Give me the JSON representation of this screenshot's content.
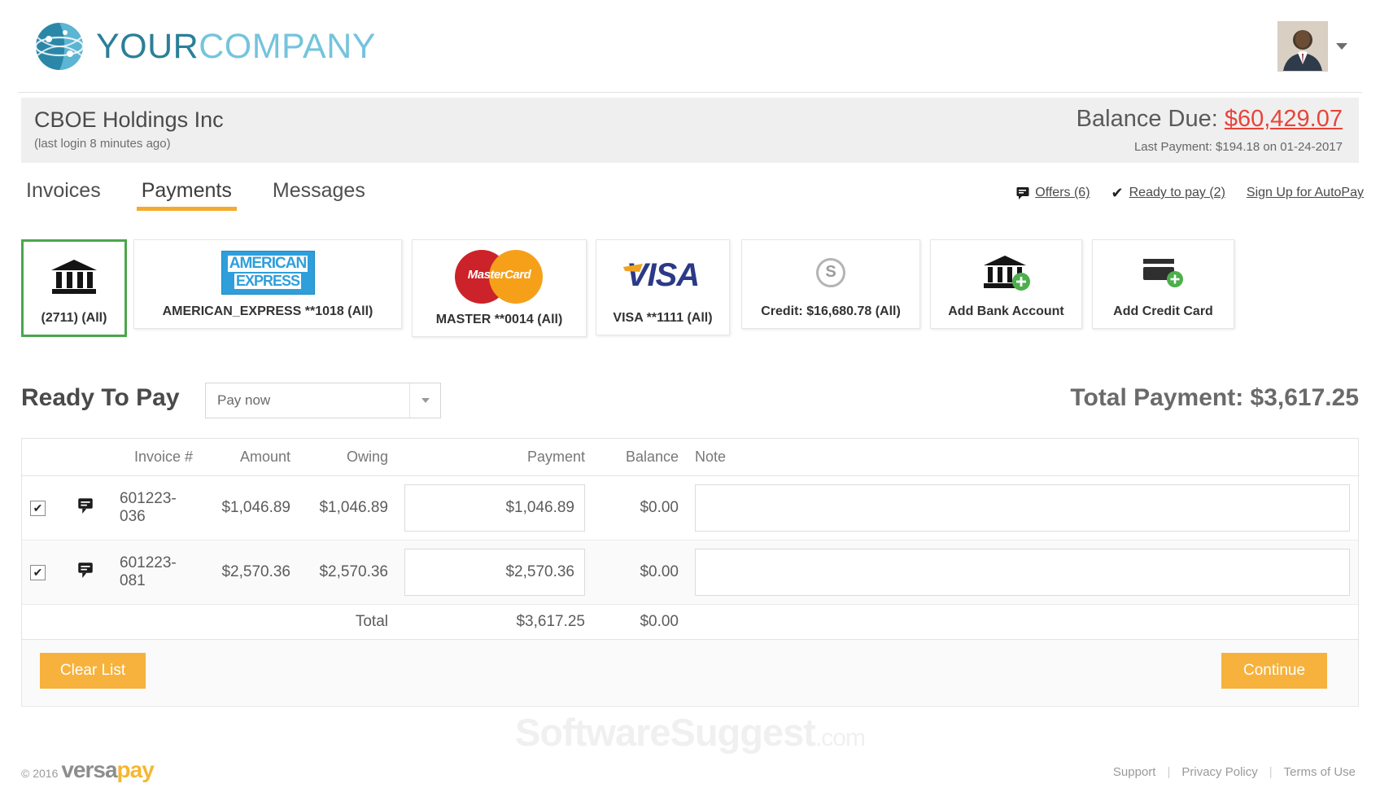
{
  "brand": {
    "logo_text_part1": "YOUR",
    "logo_text_part2": "COMPANY",
    "logo_icon": "globe-icon",
    "accent_color": "#f3ab2e",
    "brand_blue": "#2b7f98"
  },
  "header": {
    "avatar_icon": "user-avatar",
    "account_menu_icon": "chevron-down-icon"
  },
  "account": {
    "name": "CBOE Holdings Inc",
    "last_login": "(last login 8 minutes ago)",
    "balance_label": "Balance Due:",
    "balance_amount": "$60,429.07",
    "balance_color": "#e8443a",
    "last_payment": "Last Payment: $194.18 on 01-24-2017"
  },
  "nav": {
    "tabs": [
      {
        "label": "Invoices",
        "active": false
      },
      {
        "label": "Payments",
        "active": true
      },
      {
        "label": "Messages",
        "active": false
      }
    ],
    "quick_links": [
      {
        "label": "Offers (6)",
        "icon": "tag-icon"
      },
      {
        "label": "Ready to pay (2)",
        "icon": "checkmark-icon"
      },
      {
        "label": "Sign Up for AutoPay",
        "icon": ""
      }
    ]
  },
  "payment_methods": [
    {
      "label": "(2711) (All)",
      "icon": "bank-icon",
      "selected": true
    },
    {
      "label": "AMERICAN_EXPRESS **1018 (All)",
      "icon": "amex-logo",
      "selected": false
    },
    {
      "label": "MASTER **0014 (All)",
      "icon": "mastercard-logo",
      "selected": false
    },
    {
      "label": "VISA **1111 (All)",
      "icon": "visa-logo",
      "selected": false
    },
    {
      "label": "Credit: $16,680.78 (All)",
      "icon": "credit-coin-icon",
      "selected": false
    },
    {
      "label": "Add Bank Account",
      "icon": "add-bank-icon",
      "selected": false
    },
    {
      "label": "Add Credit Card",
      "icon": "add-card-icon",
      "selected": false
    }
  ],
  "ready_to_pay": {
    "title": "Ready To Pay",
    "select_value": "Pay now",
    "select_options": [
      "Pay now"
    ],
    "total_label": "Total Payment: $3,617.25"
  },
  "table": {
    "headers": [
      "",
      "",
      "Invoice #",
      "Amount",
      "Owing",
      "Payment",
      "Balance",
      "Note"
    ],
    "rows": [
      {
        "checked": true,
        "note_icon": "note-icon",
        "invoice": "601223-036",
        "amount": "$1,046.89",
        "owing": "$1,046.89",
        "payment": "$1,046.89",
        "balance": "$0.00",
        "note": ""
      },
      {
        "checked": true,
        "note_icon": "note-icon",
        "invoice": "601223-081",
        "amount": "$2,570.36",
        "owing": "$2,570.36",
        "payment": "$2,570.36",
        "balance": "$0.00",
        "note": ""
      }
    ],
    "total_row": {
      "label": "Total",
      "payment": "$3,617.25",
      "balance": "$0.00"
    }
  },
  "actions": {
    "clear_list": "Clear List",
    "continue": "Continue"
  },
  "watermark": {
    "text": "SoftwareSuggest",
    "domain": ".com"
  },
  "footer": {
    "copyright": "© 2016",
    "vendor_part1": "versa",
    "vendor_part2": "pay",
    "links": [
      "Support",
      "Privacy Policy",
      "Terms of Use"
    ],
    "separator": "|"
  }
}
